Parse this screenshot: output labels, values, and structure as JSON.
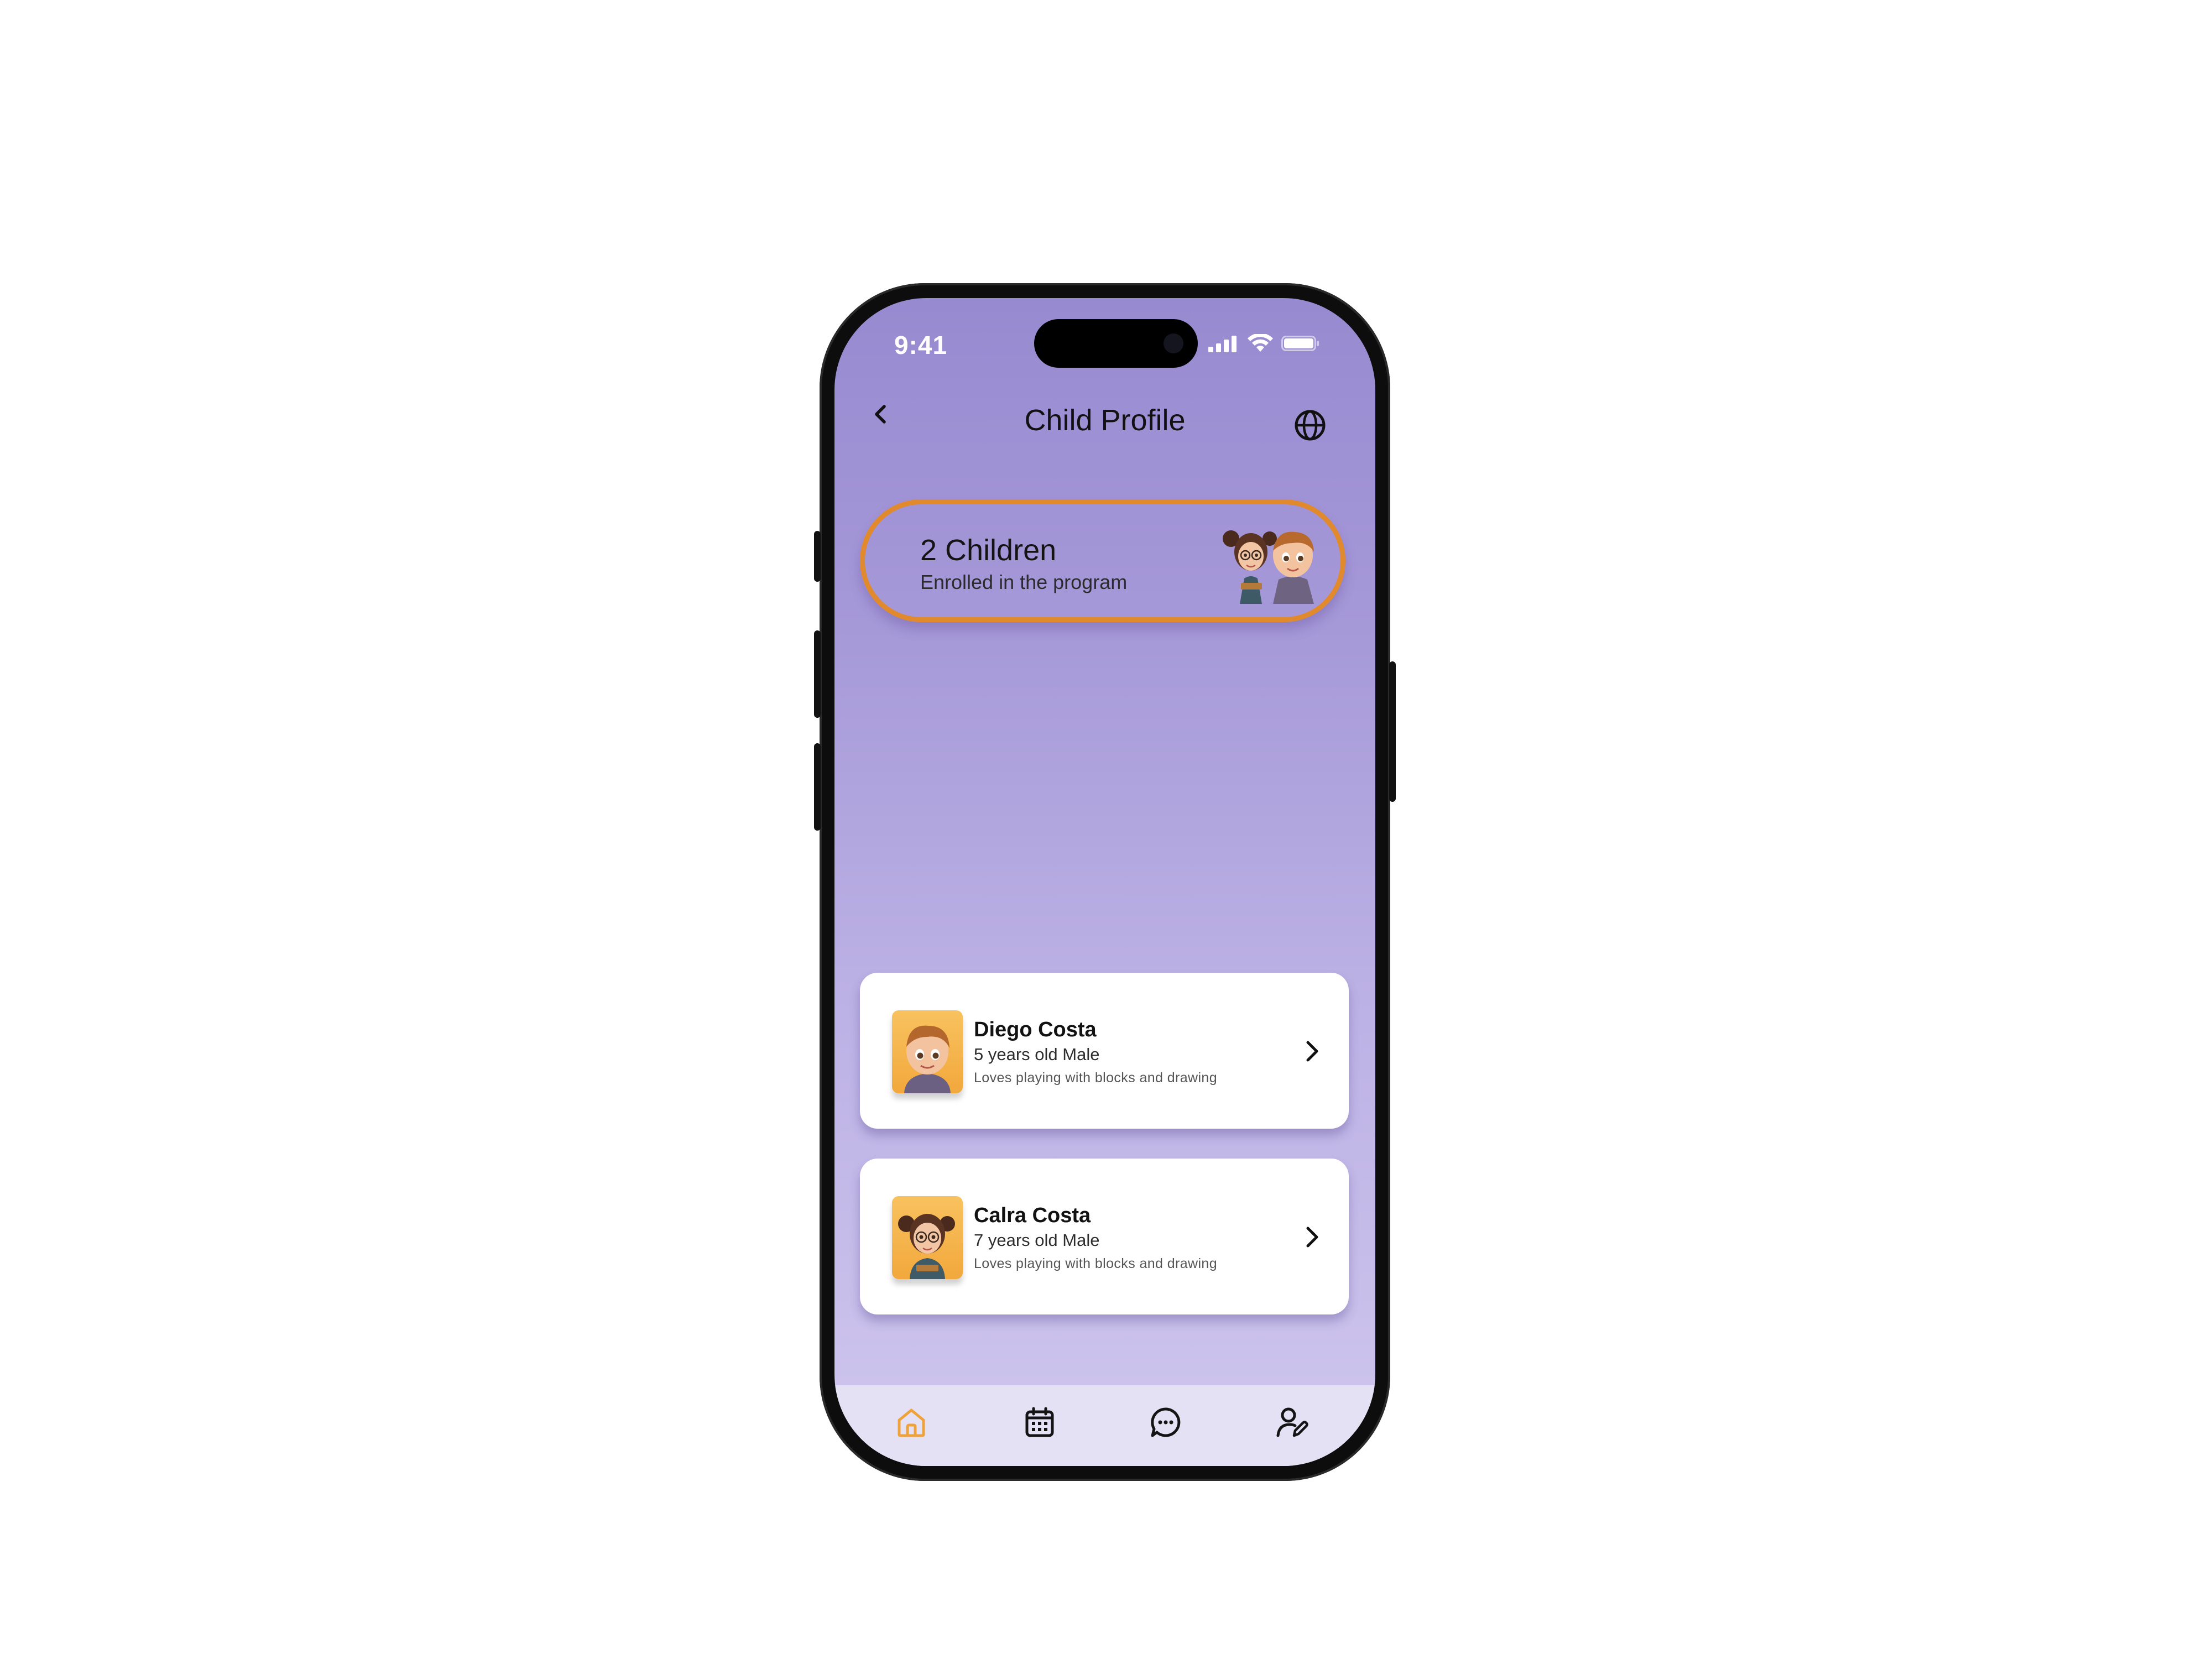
{
  "status_bar": {
    "time": "9:41",
    "icons": [
      "signal-icon",
      "wifi-icon",
      "battery-icon"
    ]
  },
  "header": {
    "title": "Child Profile",
    "back_icon": "back-chevron-icon",
    "language_icon": "globe-icon"
  },
  "summary": {
    "count_label": "2 Children",
    "subtitle": "Enrolled in the program",
    "illustration": "children-illustration"
  },
  "children": [
    {
      "name": "Diego Costa",
      "meta": "5 years old Male",
      "description": "Loves playing with blocks and drawing",
      "avatar": "boy-avatar"
    },
    {
      "name": "Calra Costa",
      "meta": "7 years old Male",
      "description": "Loves playing with blocks and drawing",
      "avatar": "girl-avatar"
    }
  ],
  "tab_bar": {
    "tabs": [
      {
        "icon": "home-icon",
        "active": true
      },
      {
        "icon": "calendar-icon",
        "active": false
      },
      {
        "icon": "chat-icon",
        "active": false
      },
      {
        "icon": "profile-edit-icon",
        "active": false
      }
    ]
  },
  "colors": {
    "accent": "#f0a23a",
    "pill_border": "#e0892d",
    "gradient_top": "#978ad0",
    "gradient_bottom": "#cfc6ee",
    "tab_bar_bg": "#e5e1f5",
    "card_bg": "#ffffff"
  }
}
